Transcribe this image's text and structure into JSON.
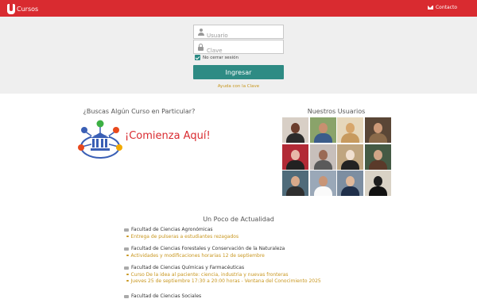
{
  "header": {
    "logo_text": "Cursos",
    "contact_label": "Contacto",
    "brand_color": "#d92b30"
  },
  "login": {
    "username_placeholder": "Usuario",
    "password_placeholder": "Clave",
    "remember_label": "No cerrar sesión",
    "remember_checked": true,
    "submit_label": "Ingresar",
    "help_link": "Ayuda con la Clave",
    "accent_color": "#2e8b84"
  },
  "promo": {
    "title": "¿Buscas Algún Curso en Particular?",
    "cta": "¡Comienza Aquí!"
  },
  "users": {
    "title": "Nuestros Usuarios",
    "photo_count": 12
  },
  "news": {
    "title": "Un Poco de Actualidad",
    "groups": [
      {
        "faculty": "Facultad de Ciencias Agronómicas",
        "items": [
          "Entrega de pulseras a estudiantes rezagados"
        ]
      },
      {
        "faculty": "Facultad de Ciencias Forestales y Conservación de la Naturaleza",
        "items": [
          "Actividades y modificaciones horarias 12 de septiembre"
        ]
      },
      {
        "faculty": "Facultad de Ciencias Químicas y Farmacéuticas",
        "items": [
          "Curso De la idea al paciente: ciencia, industria y nuevas fronteras",
          "Jueves 25 de septiembre 17:30 a 20:00 horas - Ventana del Conocimiento 2025"
        ]
      }
    ],
    "truncated_heading": "Facultad de Ciencias Sociales"
  }
}
